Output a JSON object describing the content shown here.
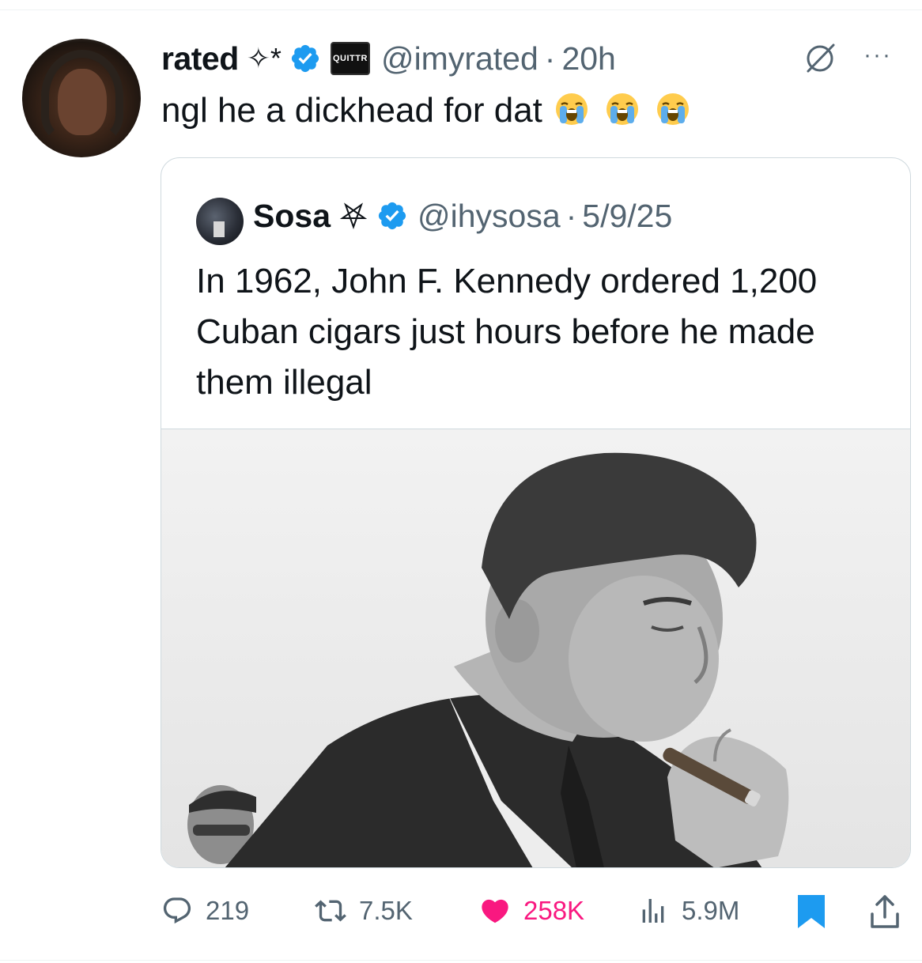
{
  "tweet": {
    "display_name": "rated",
    "name_decoration": "✧*",
    "affiliation_badge": "QUITTR",
    "handle": "@imyrated",
    "separator": "·",
    "time": "20h",
    "text": "ngl he a dickhead for dat",
    "emojis": [
      "loudly-crying-face",
      "loudly-crying-face",
      "loudly-crying-face"
    ],
    "more_label": "···"
  },
  "quote": {
    "display_name": "Sosa",
    "name_decoration_icon": "pentagram-icon",
    "handle": "@ihysosa",
    "separator": "·",
    "date": "5/9/25",
    "text": "In 1962, John F. Kennedy ordered 1,200 Cuban cigars just hours before he made them illegal",
    "media_icon": "photo-man-smoking-cigar"
  },
  "actions": {
    "replies": "219",
    "reposts": "7.5K",
    "likes": "258K",
    "views": "5.9M"
  },
  "colors": {
    "verified": "#1d9bf0",
    "like": "#f91880",
    "bookmark": "#1d9bf0",
    "secondary_text": "#536471",
    "border": "#cfd9de"
  }
}
